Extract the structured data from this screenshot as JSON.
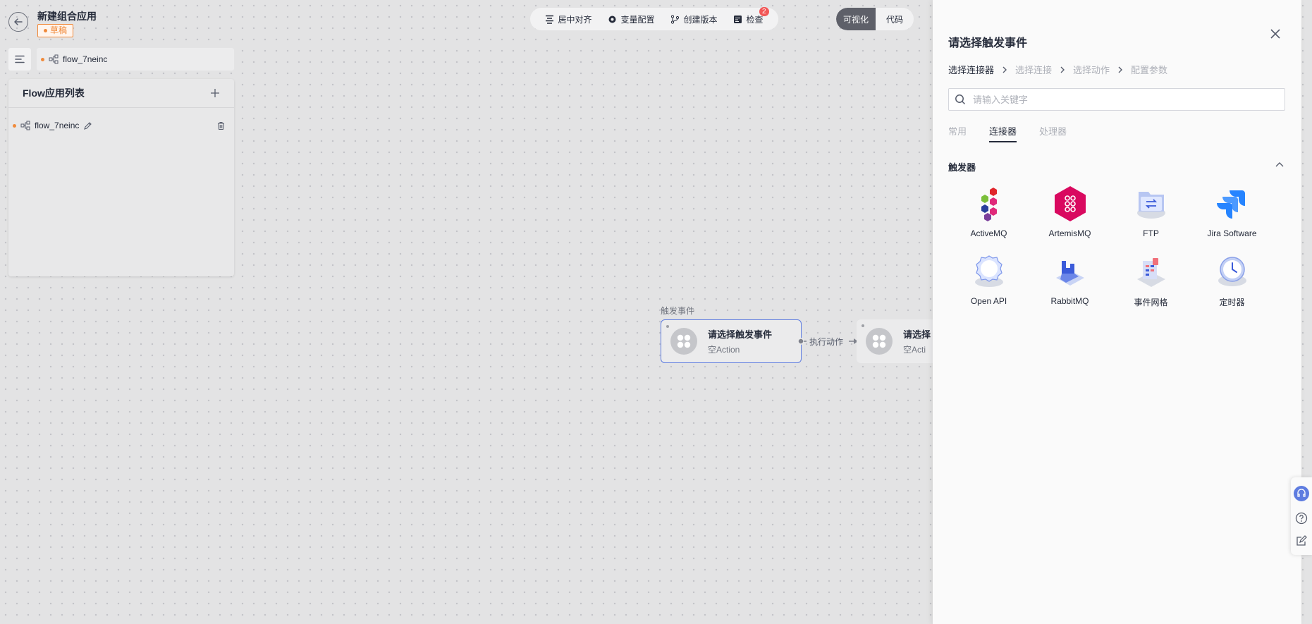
{
  "header": {
    "app_title": "新建组合应用",
    "status_badge": "草稿"
  },
  "flow_tab": {
    "name": "flow_7neinc"
  },
  "flow_list": {
    "title": "Flow应用列表",
    "items": [
      {
        "name": "flow_7neinc"
      }
    ]
  },
  "toolbar": {
    "center_align": "居中对齐",
    "variable_config": "变量配置",
    "create_version": "创建版本",
    "check": "检查",
    "check_badge": "2"
  },
  "mode_switch": {
    "visual": "可视化",
    "code": "代码"
  },
  "canvas": {
    "caption": "触发事件",
    "trigger_node": {
      "title": "请选择触发事件",
      "subtitle": "空Action"
    },
    "edge_label": "执行动作",
    "action_node": {
      "title": "请选择",
      "subtitle": "空Acti"
    }
  },
  "drawer": {
    "title": "请选择触发事件",
    "steps": [
      "选择连接器",
      "选择连接",
      "选择动作",
      "配置参数"
    ],
    "search_placeholder": "请输入关键字",
    "tabs": [
      "常用",
      "连接器",
      "处理器"
    ],
    "active_tab": "连接器",
    "section_title": "触发器",
    "connectors": [
      {
        "name": "ActiveMQ",
        "icon": "activemq-icon"
      },
      {
        "name": "ArtemisMQ",
        "icon": "artemismq-icon"
      },
      {
        "name": "FTP",
        "icon": "ftp-icon"
      },
      {
        "name": "Jira Software",
        "icon": "jira-icon"
      },
      {
        "name": "Open API",
        "icon": "openapi-icon"
      },
      {
        "name": "RabbitMQ",
        "icon": "rabbitmq-icon"
      },
      {
        "name": "事件网格",
        "icon": "event-grid-icon"
      },
      {
        "name": "定时器",
        "icon": "timer-icon"
      }
    ]
  },
  "colors": {
    "accent": "#5e7ce0",
    "draft": "#f08a3b",
    "badge": "#f25757",
    "artemis": "#d9095f",
    "jira": "#2684ff"
  }
}
